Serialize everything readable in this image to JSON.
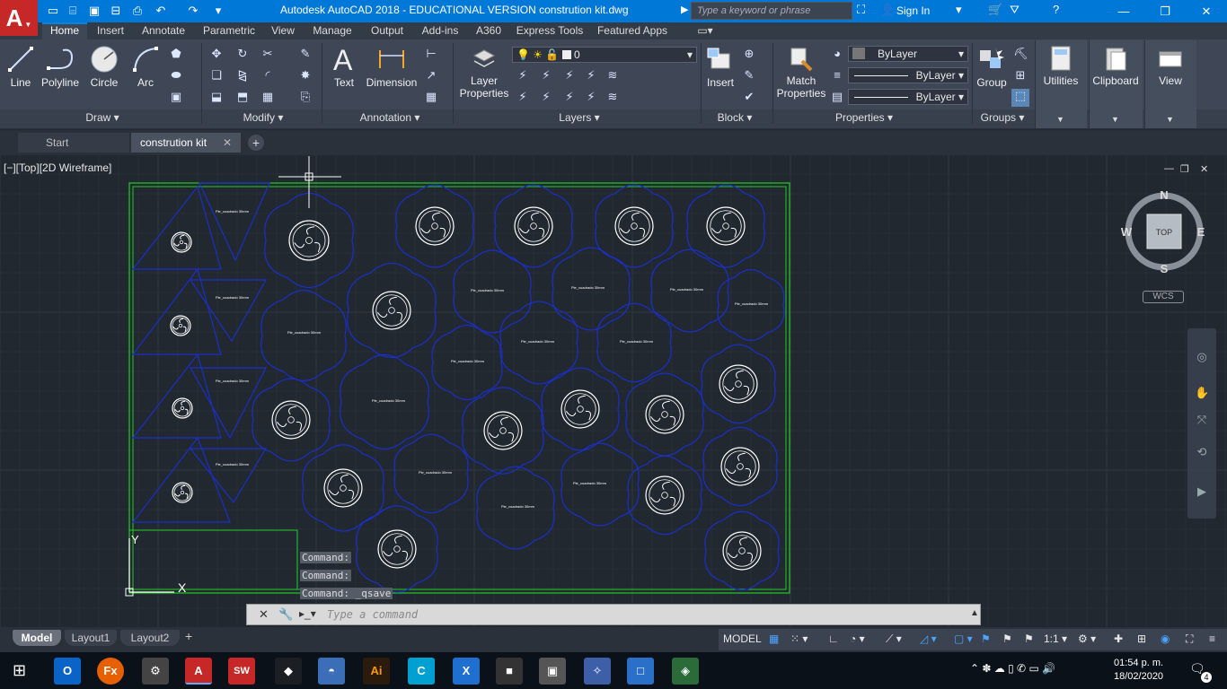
{
  "window": {
    "title": "Autodesk AutoCAD 2018 - EDUCATIONAL VERSION    constrution kit.dwg",
    "search_placeholder": "Type a keyword or phrase",
    "sign_in": "Sign In"
  },
  "ribbon_tabs": [
    "Home",
    "Insert",
    "Annotate",
    "Parametric",
    "View",
    "Manage",
    "Output",
    "Add-ins",
    "A360",
    "Express Tools",
    "Featured Apps"
  ],
  "ribbon": {
    "draw": {
      "label": "Draw",
      "buttons": [
        "Line",
        "Polyline",
        "Circle",
        "Arc"
      ]
    },
    "modify": {
      "label": "Modify"
    },
    "annotation": {
      "label": "Annotation",
      "buttons": [
        "Text",
        "Dimension"
      ]
    },
    "layers": {
      "label": "Layers",
      "layer_properties": "Layer Properties",
      "current_layer": "0"
    },
    "block": {
      "label": "Block",
      "insert": "Insert"
    },
    "properties": {
      "label": "Properties",
      "match": "Match Properties",
      "color": "ByLayer",
      "linetype": "ByLayer",
      "lineweight": "ByLayer"
    },
    "groups": {
      "label": "Groups",
      "group": "Group"
    },
    "utilities": "Utilities",
    "clipboard": "Clipboard",
    "view": "View"
  },
  "doc_tabs": [
    "Start",
    "constrution kit"
  ],
  "viewport": {
    "label": "[−][Top][2D Wireframe]",
    "viewcube": {
      "top": "TOP",
      "n": "N",
      "s": "S",
      "e": "E",
      "w": "W",
      "wcs": "WCS"
    },
    "ucs_x": "X",
    "ucs_y": "Y"
  },
  "command_history": [
    "Command:",
    "Command:",
    "Command: _qsave"
  ],
  "command_placeholder": "Type a command",
  "layout_tabs": [
    "Model",
    "Layout1",
    "Layout2"
  ],
  "statusbar": {
    "mode": "MODEL",
    "scale": "1:1"
  },
  "taskbar": {
    "time": "01:54 p. m.",
    "date": "18/02/2020",
    "notifications": "4",
    "apps": [
      "O",
      "Fx",
      "⚙",
      "A",
      "SW",
      "◆",
      "◓",
      "Ai",
      "C",
      "X",
      "■",
      "▣",
      "✧",
      "□",
      "◈"
    ]
  },
  "drawing": {
    "part_label": "Pie_cuadrado 30mm",
    "colors": {
      "piece_stroke": "#1a2fc8",
      "frame": "#22cc22",
      "circle": "#ffffff",
      "grid_minor": "#262e38",
      "grid_major": "#2f3843"
    }
  }
}
